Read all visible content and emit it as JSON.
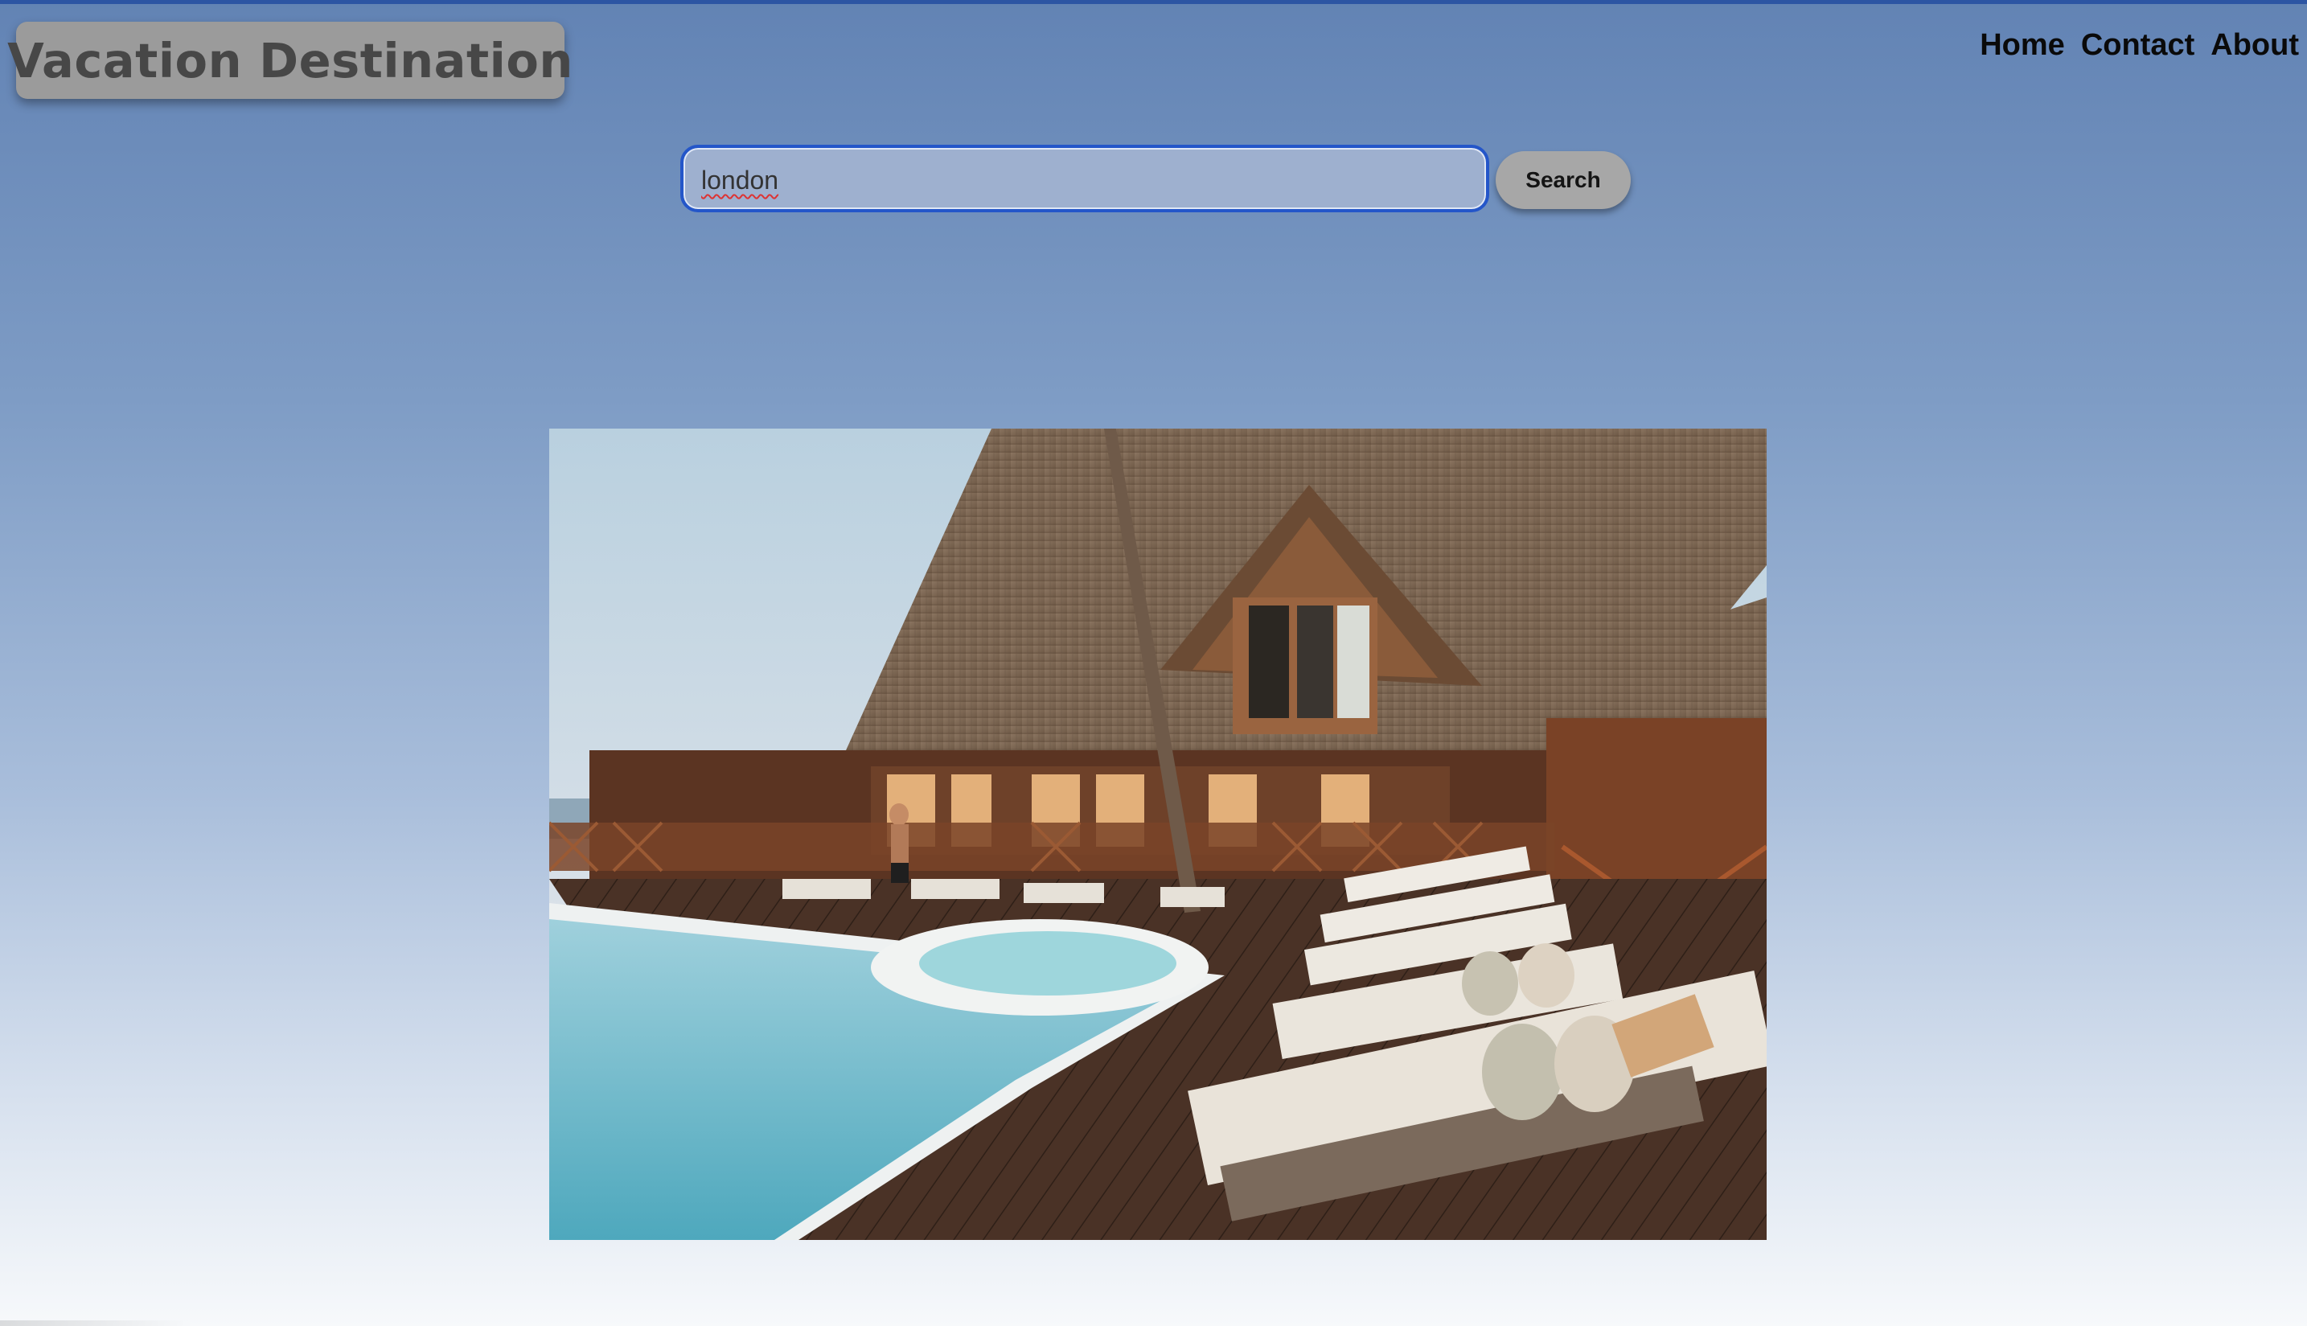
{
  "header": {
    "brand_title": "Vacation Destination",
    "nav": [
      "Home",
      "Contact",
      "About"
    ]
  },
  "search": {
    "value": "london",
    "button_label": "Search"
  },
  "hero": {
    "image_subject": "resort pool deck with wooden lodge and lounge chairs"
  },
  "colors": {
    "accent": "#2456c9",
    "background_top": "#6283b4",
    "background_bottom": "#f7f9fb",
    "brand_box": "#9b9b9b",
    "button": "#a7a7a7"
  }
}
